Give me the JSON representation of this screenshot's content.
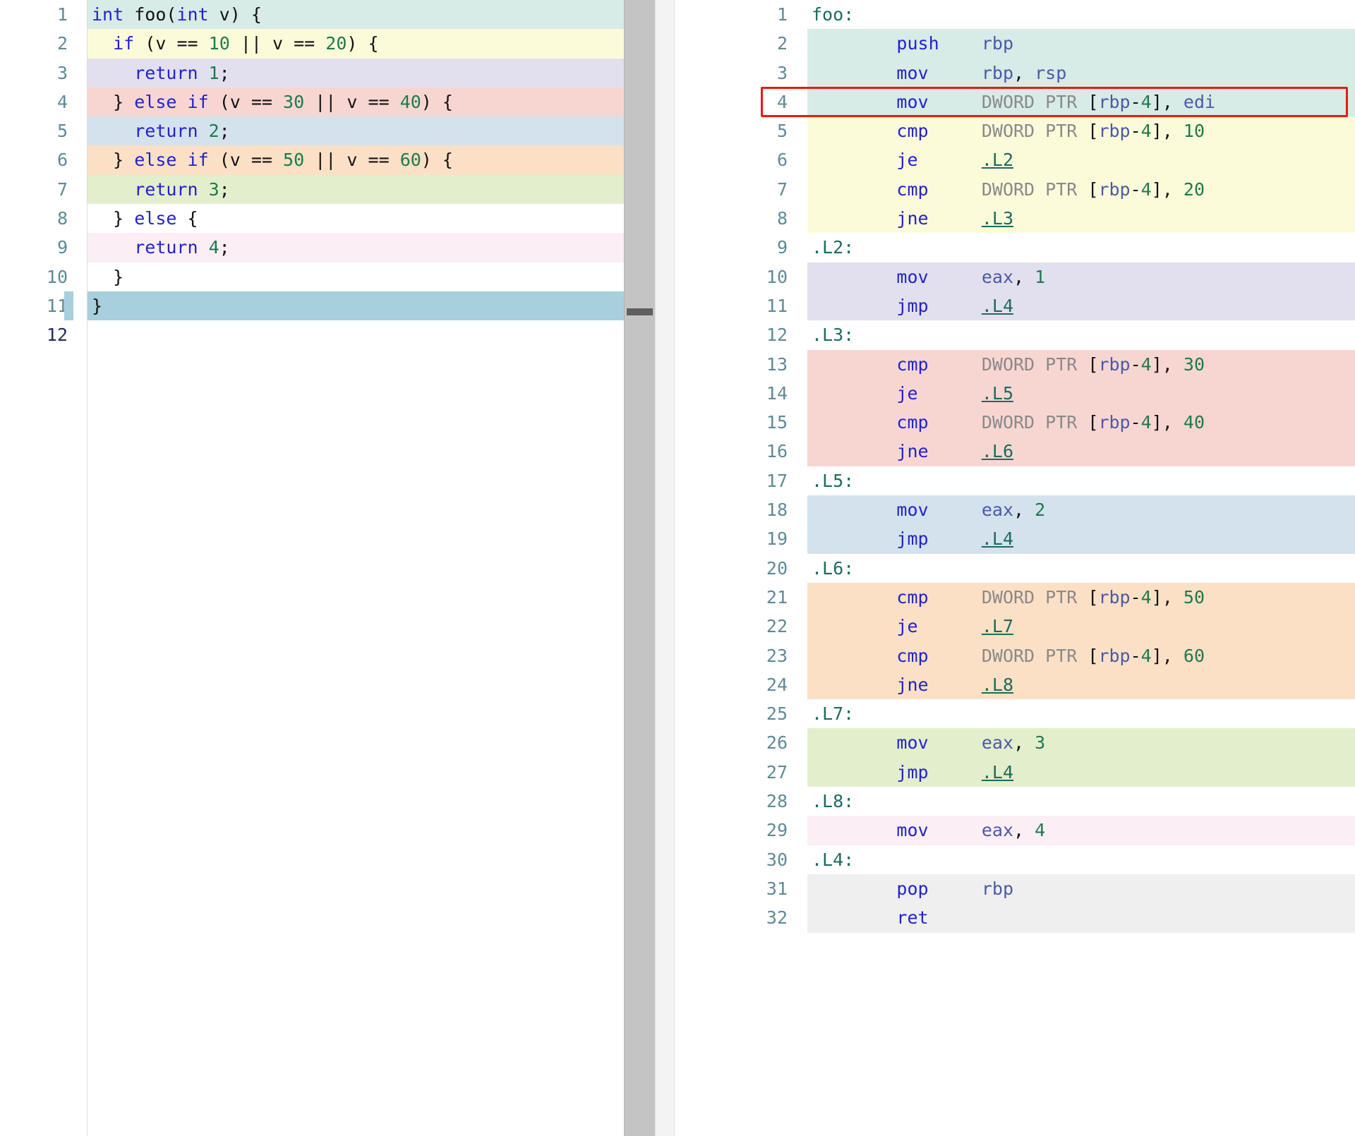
{
  "app": {
    "name": "compiler-explorer",
    "layout": "two-pane-split"
  },
  "colors": {
    "teal": "#d7ebe7",
    "yellow": "#fbfbda",
    "purple": "#e2e0ee",
    "red": "#f7d6d2",
    "blue": "#d4e2ed",
    "orange": "#fbe0c6",
    "green": "#e3eecd",
    "pink": "#fbeef5",
    "gray": "#efefef",
    "active_line": "#a8cfdd",
    "annotation_border": "#e81b0e",
    "keyword": "#2222cc",
    "number": "#1e7a4d",
    "label": "#1c6b5e",
    "register": "#4a5aa8",
    "directive": "#8a8a8a",
    "gutter_text": "#5f8a96"
  },
  "source_editor": {
    "language": "C++",
    "lines": [
      {
        "n": "1",
        "hl": "c-teal",
        "text": "int foo(int v) {"
      },
      {
        "n": "2",
        "hl": "c-yellow",
        "text": "  if (v == 10 || v == 20) {"
      },
      {
        "n": "3",
        "hl": "c-purple",
        "text": "    return 1;"
      },
      {
        "n": "4",
        "hl": "c-red",
        "text": "  } else if (v == 30 || v == 40) {"
      },
      {
        "n": "5",
        "hl": "c-blue",
        "text": "    return 2;"
      },
      {
        "n": "6",
        "hl": "c-orange",
        "text": "  } else if (v == 50 || v == 60) {"
      },
      {
        "n": "7",
        "hl": "c-green",
        "text": "    return 3;"
      },
      {
        "n": "8",
        "hl": "c-none",
        "text": "  } else {"
      },
      {
        "n": "9",
        "hl": "c-pink",
        "text": "    return 4;"
      },
      {
        "n": "10",
        "hl": "c-none",
        "text": "  }"
      },
      {
        "n": "11",
        "hl": "c-active",
        "text": "}"
      },
      {
        "n": "12",
        "hl": "c-none",
        "text": ""
      }
    ],
    "cursor_line": "11",
    "active_line_number": "12"
  },
  "asm_editor": {
    "language": "x86-64 asm",
    "lines": [
      {
        "n": "1",
        "hl": "c-none",
        "mnemonic": "",
        "operands": "foo:"
      },
      {
        "n": "2",
        "hl": "c-teal",
        "mnemonic": "push",
        "operands": "rbp"
      },
      {
        "n": "3",
        "hl": "c-teal",
        "mnemonic": "mov",
        "operands": "rbp, rsp"
      },
      {
        "n": "4",
        "hl": "c-teal",
        "mnemonic": "mov",
        "operands": "DWORD PTR [rbp-4], edi"
      },
      {
        "n": "5",
        "hl": "c-yellow",
        "mnemonic": "cmp",
        "operands": "DWORD PTR [rbp-4], 10"
      },
      {
        "n": "6",
        "hl": "c-yellow",
        "mnemonic": "je",
        "operands": ".L2"
      },
      {
        "n": "7",
        "hl": "c-yellow",
        "mnemonic": "cmp",
        "operands": "DWORD PTR [rbp-4], 20"
      },
      {
        "n": "8",
        "hl": "c-yellow",
        "mnemonic": "jne",
        "operands": ".L3"
      },
      {
        "n": "9",
        "hl": "c-none",
        "mnemonic": "",
        "operands": ".L2:"
      },
      {
        "n": "10",
        "hl": "c-purple",
        "mnemonic": "mov",
        "operands": "eax, 1"
      },
      {
        "n": "11",
        "hl": "c-purple",
        "mnemonic": "jmp",
        "operands": ".L4"
      },
      {
        "n": "12",
        "hl": "c-none",
        "mnemonic": "",
        "operands": ".L3:"
      },
      {
        "n": "13",
        "hl": "c-red",
        "mnemonic": "cmp",
        "operands": "DWORD PTR [rbp-4], 30"
      },
      {
        "n": "14",
        "hl": "c-red",
        "mnemonic": "je",
        "operands": ".L5"
      },
      {
        "n": "15",
        "hl": "c-red",
        "mnemonic": "cmp",
        "operands": "DWORD PTR [rbp-4], 40"
      },
      {
        "n": "16",
        "hl": "c-red",
        "mnemonic": "jne",
        "operands": ".L6"
      },
      {
        "n": "17",
        "hl": "c-none",
        "mnemonic": "",
        "operands": ".L5:"
      },
      {
        "n": "18",
        "hl": "c-blue",
        "mnemonic": "mov",
        "operands": "eax, 2"
      },
      {
        "n": "19",
        "hl": "c-blue",
        "mnemonic": "jmp",
        "operands": ".L4"
      },
      {
        "n": "20",
        "hl": "c-none",
        "mnemonic": "",
        "operands": ".L6:"
      },
      {
        "n": "21",
        "hl": "c-orange",
        "mnemonic": "cmp",
        "operands": "DWORD PTR [rbp-4], 50"
      },
      {
        "n": "22",
        "hl": "c-orange",
        "mnemonic": "je",
        "operands": ".L7"
      },
      {
        "n": "23",
        "hl": "c-orange",
        "mnemonic": "cmp",
        "operands": "DWORD PTR [rbp-4], 60"
      },
      {
        "n": "24",
        "hl": "c-orange",
        "mnemonic": "jne",
        "operands": ".L8"
      },
      {
        "n": "25",
        "hl": "c-none",
        "mnemonic": "",
        "operands": ".L7:"
      },
      {
        "n": "26",
        "hl": "c-green",
        "mnemonic": "mov",
        "operands": "eax, 3"
      },
      {
        "n": "27",
        "hl": "c-green",
        "mnemonic": "jmp",
        "operands": ".L4"
      },
      {
        "n": "28",
        "hl": "c-none",
        "mnemonic": "",
        "operands": ".L8:"
      },
      {
        "n": "29",
        "hl": "c-pink",
        "mnemonic": "mov",
        "operands": "eax, 4"
      },
      {
        "n": "30",
        "hl": "c-none",
        "mnemonic": "",
        "operands": ".L4:"
      },
      {
        "n": "31",
        "hl": "c-gray",
        "mnemonic": "pop",
        "operands": "rbp"
      },
      {
        "n": "32",
        "hl": "c-gray",
        "mnemonic": "ret",
        "operands": ""
      }
    ]
  },
  "annotation": {
    "target_line": "4",
    "target_text": "mov     DWORD PTR [rbp-4], edi",
    "shape": "rectangle",
    "color": "#e81b0e"
  },
  "scrollbar": {
    "orientation": "vertical",
    "handle_label": "source-scroll-handle"
  }
}
